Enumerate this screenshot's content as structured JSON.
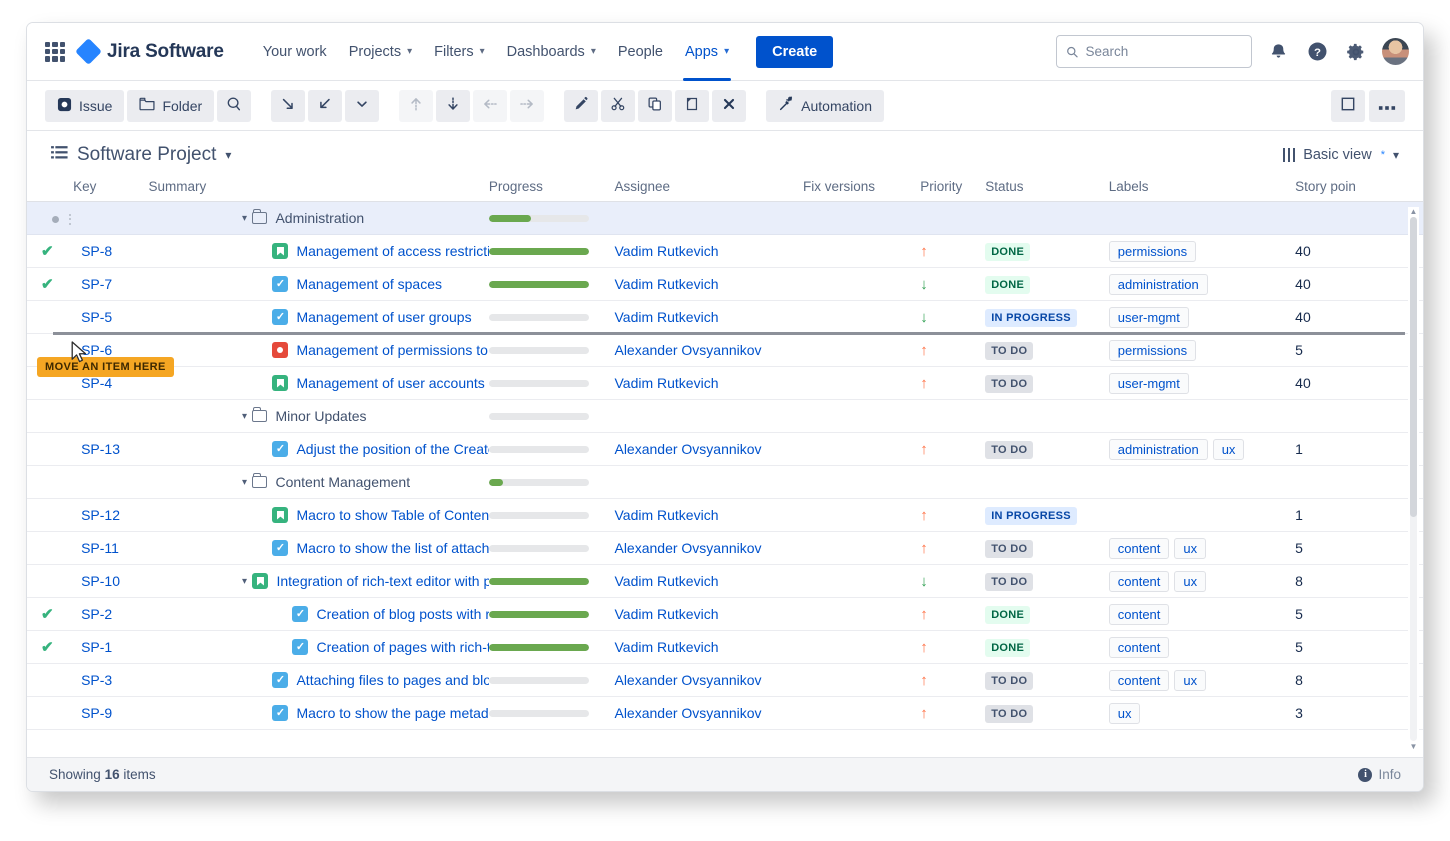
{
  "nav": {
    "brand": "Jira Software",
    "items": [
      {
        "label": "Your work",
        "caret": false,
        "active": false
      },
      {
        "label": "Projects",
        "caret": true,
        "active": false
      },
      {
        "label": "Filters",
        "caret": true,
        "active": false
      },
      {
        "label": "Dashboards",
        "caret": true,
        "active": false
      },
      {
        "label": "People",
        "caret": false,
        "active": false
      },
      {
        "label": "Apps",
        "caret": true,
        "active": true
      }
    ],
    "create_label": "Create",
    "search_placeholder": "Search",
    "search_value": "",
    "icons": [
      "app-switcher-icon",
      "notifications-icon",
      "help-icon",
      "settings-icon",
      "avatar"
    ]
  },
  "toolbar": {
    "issue_label": "Issue",
    "folder_label": "Folder",
    "automation_label": "Automation",
    "buttons": [
      "new-issue-button",
      "new-folder-button",
      "search-button",
      "expand-all-button",
      "collapse-all-button",
      "expand-options-button",
      "move-up-button",
      "move-down-button",
      "outdent-button",
      "indent-button",
      "edit-button",
      "cut-button",
      "copy-button",
      "paste-button",
      "delete-button",
      "automation-button",
      "fullscreen-button",
      "more-options-button"
    ]
  },
  "project": {
    "title": "Software Project",
    "view_label": "Basic view",
    "view_modified_marker": "*"
  },
  "columns": [
    {
      "key": "check",
      "label": ""
    },
    {
      "key": "key",
      "label": "Key"
    },
    {
      "key": "summary",
      "label": "Summary"
    },
    {
      "key": "progress",
      "label": "Progress"
    },
    {
      "key": "assignee",
      "label": "Assignee"
    },
    {
      "key": "fix_versions",
      "label": "Fix versions"
    },
    {
      "key": "priority",
      "label": "Priority"
    },
    {
      "key": "status",
      "label": "Status"
    },
    {
      "key": "labels",
      "label": "Labels"
    },
    {
      "key": "story_points",
      "label": "Story poin"
    }
  ],
  "rows": [
    {
      "type": "folder",
      "indent": 3,
      "selected": true,
      "done": false,
      "key": "",
      "summary": "Administration",
      "progress": 42,
      "assignee": "",
      "fix_versions": "",
      "priority": "",
      "status": "",
      "labels": [],
      "story_points": "",
      "icon": "folder-icon",
      "chevron": "down"
    },
    {
      "type": "issue",
      "indent": 4,
      "selected": false,
      "done": true,
      "key": "SP-8",
      "summary": "Management of access restrictions",
      "progress": 100,
      "assignee": "Vadim Rutkevich",
      "fix_versions": "",
      "priority": "high",
      "status": "DONE",
      "labels": [
        "permissions"
      ],
      "story_points": "40",
      "icon": "story-icon"
    },
    {
      "type": "issue",
      "indent": 4,
      "selected": false,
      "done": true,
      "key": "SP-7",
      "summary": "Management of spaces",
      "progress": 100,
      "assignee": "Vadim Rutkevich",
      "fix_versions": "",
      "priority": "low",
      "status": "DONE",
      "labels": [
        "administration"
      ],
      "story_points": "40",
      "icon": "task-icon"
    },
    {
      "type": "issue",
      "indent": 4,
      "selected": false,
      "done": false,
      "key": "SP-5",
      "summary": "Management of user groups",
      "progress": 0,
      "assignee": "Vadim Rutkevich",
      "fix_versions": "",
      "priority": "low",
      "status": "IN PROGRESS",
      "labels": [
        "user-mgmt"
      ],
      "story_points": "40",
      "icon": "task-icon"
    },
    {
      "type": "issue",
      "indent": 4,
      "selected": false,
      "done": false,
      "key": "SP-6",
      "summary": "Management of permissions to spaces",
      "progress": 0,
      "assignee": "Alexander Ovsyannikov",
      "fix_versions": "",
      "priority": "high",
      "status": "TO DO",
      "labels": [
        "permissions"
      ],
      "story_points": "5",
      "icon": "bug-icon"
    },
    {
      "type": "issue",
      "indent": 4,
      "selected": false,
      "done": false,
      "key": "SP-4",
      "summary": "Management of user accounts",
      "progress": 0,
      "assignee": "Vadim Rutkevich",
      "fix_versions": "",
      "priority": "high",
      "status": "TO DO",
      "labels": [
        "user-mgmt"
      ],
      "story_points": "40",
      "icon": "story-icon"
    },
    {
      "type": "folder",
      "indent": 3,
      "selected": false,
      "done": false,
      "key": "",
      "summary": "Minor Updates",
      "progress": 0,
      "assignee": "",
      "fix_versions": "",
      "priority": "",
      "status": "",
      "labels": [],
      "story_points": "",
      "icon": "folder-icon",
      "chevron": "down"
    },
    {
      "type": "issue",
      "indent": 4,
      "selected": false,
      "done": false,
      "key": "SP-13",
      "summary": "Adjust the position of the Create button o",
      "progress": 0,
      "assignee": "Alexander Ovsyannikov",
      "fix_versions": "",
      "priority": "high",
      "status": "TO DO",
      "labels": [
        "administration",
        "ux"
      ],
      "story_points": "1",
      "icon": "task-icon"
    },
    {
      "type": "folder",
      "indent": 3,
      "selected": false,
      "done": false,
      "key": "",
      "summary": "Content Management",
      "progress": 14,
      "assignee": "",
      "fix_versions": "",
      "priority": "",
      "status": "",
      "labels": [],
      "story_points": "",
      "icon": "folder-icon",
      "chevron": "down"
    },
    {
      "type": "issue",
      "indent": 4,
      "selected": false,
      "done": false,
      "key": "SP-12",
      "summary": "Macro to show Table of Contents",
      "progress": 0,
      "assignee": "Vadim Rutkevich",
      "fix_versions": "",
      "priority": "high",
      "status": "IN PROGRESS",
      "labels": [],
      "story_points": "1",
      "icon": "story-icon"
    },
    {
      "type": "issue",
      "indent": 4,
      "selected": false,
      "done": false,
      "key": "SP-11",
      "summary": "Macro to show the list of attachments",
      "progress": 0,
      "assignee": "Alexander Ovsyannikov",
      "fix_versions": "",
      "priority": "high",
      "status": "TO DO",
      "labels": [
        "content",
        "ux"
      ],
      "story_points": "5",
      "icon": "task-icon"
    },
    {
      "type": "issue",
      "indent": 3,
      "selected": false,
      "done": false,
      "key": "SP-10",
      "summary": "Integration of rich-text editor with pages a",
      "progress": 100,
      "assignee": "Vadim Rutkevich",
      "fix_versions": "",
      "priority": "low",
      "status": "TO DO",
      "labels": [
        "content",
        "ux"
      ],
      "story_points": "8",
      "icon": "story-icon",
      "chevron": "down"
    },
    {
      "type": "issue",
      "indent": 5,
      "selected": false,
      "done": true,
      "key": "SP-2",
      "summary": "Creation of blog posts with rich-text",
      "progress": 100,
      "assignee": "Vadim Rutkevich",
      "fix_versions": "",
      "priority": "high",
      "status": "DONE",
      "labels": [
        "content"
      ],
      "story_points": "5",
      "icon": "task-icon"
    },
    {
      "type": "issue",
      "indent": 5,
      "selected": false,
      "done": true,
      "key": "SP-1",
      "summary": "Creation of pages with rich-text",
      "progress": 100,
      "assignee": "Vadim Rutkevich",
      "fix_versions": "",
      "priority": "high",
      "status": "DONE",
      "labels": [
        "content"
      ],
      "story_points": "5",
      "icon": "task-icon"
    },
    {
      "type": "issue",
      "indent": 4,
      "selected": false,
      "done": false,
      "key": "SP-3",
      "summary": "Attaching files to pages and blog posts",
      "progress": 0,
      "assignee": "Alexander Ovsyannikov",
      "fix_versions": "",
      "priority": "high",
      "status": "TO DO",
      "labels": [
        "content",
        "ux"
      ],
      "story_points": "8",
      "icon": "task-icon"
    },
    {
      "type": "issue",
      "indent": 4,
      "selected": false,
      "done": false,
      "key": "SP-9",
      "summary": "Macro to show the page metadata",
      "progress": 0,
      "assignee": "Alexander Ovsyannikov",
      "fix_versions": "",
      "priority": "high",
      "status": "TO DO",
      "labels": [
        "ux"
      ],
      "story_points": "3",
      "icon": "task-icon"
    }
  ],
  "drag": {
    "tooltip": "MOVE AN ITEM HERE",
    "drop_after_row_index": 3
  },
  "footer": {
    "showing_prefix": "Showing",
    "count": "16",
    "showing_suffix": "items",
    "info_label": "Info"
  },
  "colors": {
    "brand_blue": "#0052cc",
    "link_blue": "#0052cc",
    "progress_green": "#6aa84f",
    "done_bg": "#e3fcef",
    "inprogress_bg": "#deebff",
    "todo_bg": "#dfe1e6",
    "priority_high": "#ff7043",
    "priority_low": "#2e9e4f",
    "drag_tip_bg": "#f5a623"
  }
}
